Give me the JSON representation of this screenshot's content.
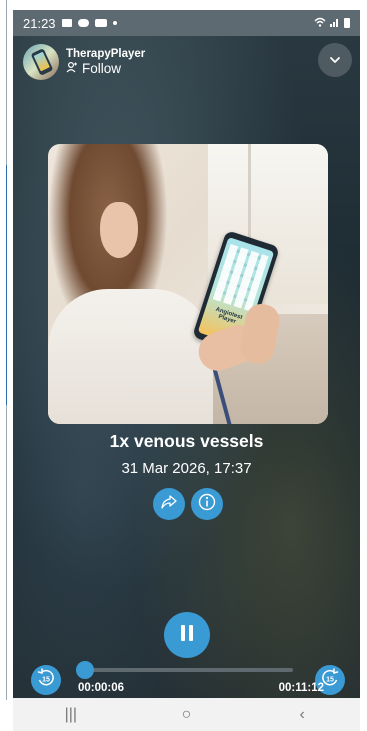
{
  "status_bar": {
    "time": "21:23",
    "icons": [
      "image-icon",
      "cloud-icon",
      "video-icon",
      "dot-icon",
      "wifi-icon",
      "signal-icon",
      "battery-icon"
    ]
  },
  "channel": {
    "name": "TherapyPlayer",
    "follow_label": "Follow"
  },
  "artwork": {
    "screen_label": "Angiotest Player"
  },
  "track": {
    "title": "1x venous vessels",
    "date": "31 Mar 2026, 17:37"
  },
  "player": {
    "current_time": "00:00:06",
    "total_time": "00:11:12",
    "progress": 0.009,
    "skip_back_label": "15",
    "skip_forward_label": "15",
    "state": "playing"
  },
  "colors": {
    "accent": "#3a9ad3"
  },
  "nav": {
    "recents": "|||",
    "home": "○",
    "back": "‹"
  }
}
